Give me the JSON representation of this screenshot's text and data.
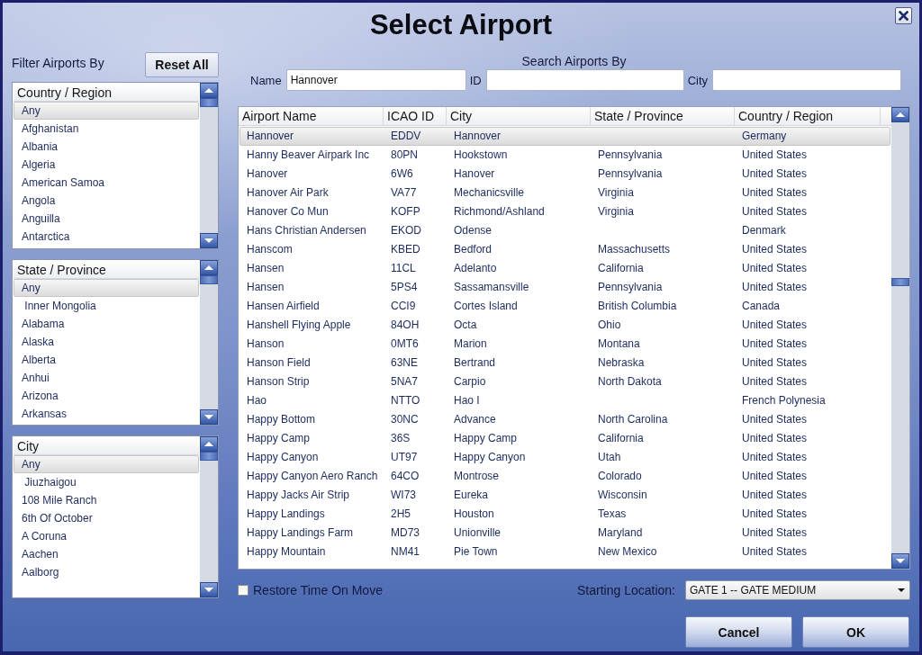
{
  "window": {
    "title": "Select Airport"
  },
  "filter": {
    "label": "Filter Airports By",
    "reset_button": "Reset All",
    "lists": [
      {
        "header": "Country / Region",
        "items": [
          {
            "label": "Any",
            "selected": true
          },
          {
            "label": "Afghanistan",
            "selected": false
          },
          {
            "label": "Albania",
            "selected": false
          },
          {
            "label": "Algeria",
            "selected": false
          },
          {
            "label": "American Samoa",
            "selected": false
          },
          {
            "label": "Angola",
            "selected": false
          },
          {
            "label": "Anguilla",
            "selected": false
          },
          {
            "label": "Antarctica",
            "selected": false
          }
        ]
      },
      {
        "header": "State / Province",
        "items": [
          {
            "label": "Any",
            "selected": true
          },
          {
            "label": " Inner Mongolia",
            "selected": false
          },
          {
            "label": "Alabama",
            "selected": false
          },
          {
            "label": "Alaska",
            "selected": false
          },
          {
            "label": "Alberta",
            "selected": false
          },
          {
            "label": "Anhui",
            "selected": false
          },
          {
            "label": "Arizona",
            "selected": false
          },
          {
            "label": "Arkansas",
            "selected": false
          }
        ]
      },
      {
        "header": "City",
        "items": [
          {
            "label": "Any",
            "selected": true
          },
          {
            "label": " Jiuzhaigou",
            "selected": false
          },
          {
            "label": "108 Mile Ranch",
            "selected": false
          },
          {
            "label": "6th Of October",
            "selected": false
          },
          {
            "label": "A Coruna",
            "selected": false
          },
          {
            "label": "Aachen",
            "selected": false
          },
          {
            "label": "Aalborg",
            "selected": false
          }
        ]
      }
    ]
  },
  "search": {
    "title": "Search Airports By",
    "fields": [
      {
        "label": "Name",
        "value": "Hannover"
      },
      {
        "label": "ID"
      },
      {
        "label": "City"
      }
    ]
  },
  "table": {
    "columns": [
      "Airport Name",
      "ICAO ID",
      "City",
      "State / Province",
      "Country / Region"
    ],
    "rows": [
      {
        "name": "Hannover",
        "icao_id": "EDDV",
        "city": "Hannover",
        "country_region": "Germany",
        "selected": true
      },
      {
        "name": "Hanny Beaver Airpark Inc",
        "icao_id": "80PN",
        "city": "Hookstown",
        "state_province": "Pennsylvania",
        "country_region": "United States",
        "selected": false
      },
      {
        "name": "Hanover",
        "icao_id": "6W6",
        "city": "Hanover",
        "state_province": "Pennsylvania",
        "country_region": "United States",
        "selected": false
      },
      {
        "name": "Hanover Air Park",
        "icao_id": "VA77",
        "city": "Mechanicsville",
        "state_province": "Virginia",
        "country_region": "United States",
        "selected": false
      },
      {
        "name": "Hanover Co Mun",
        "icao_id": "KOFP",
        "city": "Richmond/Ashland",
        "state_province": "Virginia",
        "country_region": "United States",
        "selected": false
      },
      {
        "name": "Hans Christian Andersen",
        "icao_id": "EKOD",
        "city": "Odense",
        "country_region": "Denmark",
        "selected": false
      },
      {
        "name": "Hanscom",
        "icao_id": "KBED",
        "city": "Bedford",
        "state_province": "Massachusetts",
        "country_region": "United States",
        "selected": false
      },
      {
        "name": "Hansen",
        "icao_id": "11CL",
        "city": "Adelanto",
        "state_province": "California",
        "country_region": "United States",
        "selected": false
      },
      {
        "name": "Hansen",
        "icao_id": "5PS4",
        "city": "Sassamansville",
        "state_province": "Pennsylvania",
        "country_region": "United States",
        "selected": false
      },
      {
        "name": "Hansen Airfield",
        "icao_id": "CCI9",
        "city": "Cortes Island",
        "state_province": "British Columbia",
        "country_region": "Canada",
        "selected": false
      },
      {
        "name": "Hanshell Flying Apple",
        "icao_id": "84OH",
        "city": "Octa",
        "state_province": "Ohio",
        "country_region": "United States",
        "selected": false
      },
      {
        "name": "Hanson",
        "icao_id": "0MT6",
        "city": "Marion",
        "state_province": "Montana",
        "country_region": "United States",
        "selected": false
      },
      {
        "name": "Hanson Field",
        "icao_id": "63NE",
        "city": "Bertrand",
        "state_province": "Nebraska",
        "country_region": "United States",
        "selected": false
      },
      {
        "name": "Hanson Strip",
        "icao_id": "5NA7",
        "city": "Carpio",
        "state_province": "North Dakota",
        "country_region": "United States",
        "selected": false
      },
      {
        "name": "Hao",
        "icao_id": "NTTO",
        "city": "Hao I",
        "country_region": "French Polynesia",
        "selected": false
      },
      {
        "name": "Happy Bottom",
        "icao_id": "30NC",
        "city": "Advance",
        "state_province": "North Carolina",
        "country_region": "United States",
        "selected": false
      },
      {
        "name": "Happy Camp",
        "icao_id": "36S",
        "city": "Happy Camp",
        "state_province": "California",
        "country_region": "United States",
        "selected": false
      },
      {
        "name": "Happy Canyon",
        "icao_id": "UT97",
        "city": "Happy Canyon",
        "state_province": "Utah",
        "country_region": "United States",
        "selected": false
      },
      {
        "name": "Happy Canyon Aero Ranch",
        "icao_id": "64CO",
        "city": "Montrose",
        "state_province": "Colorado",
        "country_region": "United States",
        "selected": false
      },
      {
        "name": "Happy Jacks Air Strip",
        "icao_id": "WI73",
        "city": "Eureka",
        "state_province": "Wisconsin",
        "country_region": "United States",
        "selected": false
      },
      {
        "name": "Happy Landings",
        "icao_id": "2H5",
        "city": "Houston",
        "state_province": "Texas",
        "country_region": "United States",
        "selected": false
      },
      {
        "name": "Happy Landings Farm",
        "icao_id": "MD73",
        "city": "Unionville",
        "state_province": "Maryland",
        "country_region": "United States",
        "selected": false
      },
      {
        "name": "Happy Mountain",
        "icao_id": "NM41",
        "city": "Pie Town",
        "state_province": "New Mexico",
        "country_region": "United States",
        "selected": false
      }
    ]
  },
  "options": {
    "restore_time_on_move": {
      "label": "Restore Time On Move",
      "checked": false
    },
    "starting_location": {
      "label": "Starting Location:",
      "value": "GATE 1 -- GATE MEDIUM"
    }
  },
  "buttons": [
    "Cancel",
    "OK"
  ]
}
